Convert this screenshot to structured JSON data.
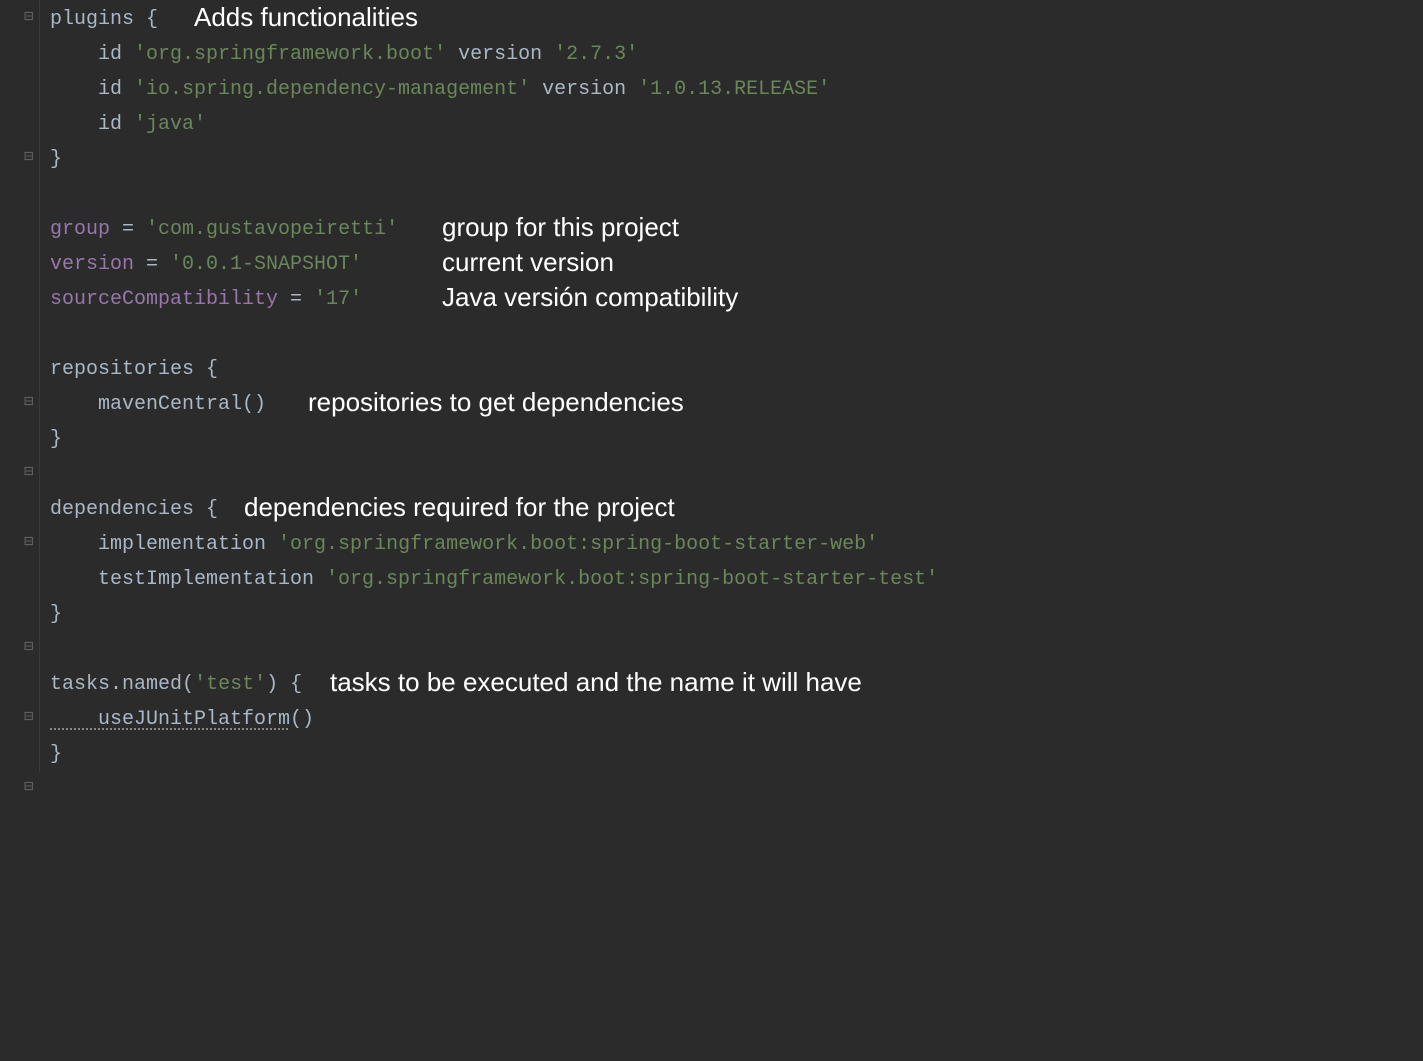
{
  "code": {
    "l1_plugins": "plugins",
    "l1_brace": " {",
    "l2_id": "    id ",
    "l2_str": "'org.springframework.boot' ",
    "l2_version": "version ",
    "l2_vstr": "'2.7.3'",
    "l3_id": "    id ",
    "l3_str": "'io.spring.dependency-management' ",
    "l3_version": "version ",
    "l3_vstr": "'1.0.13.RELEASE'",
    "l4_id": "    id ",
    "l4_str": "'java'",
    "l5_brace": "}",
    "l7_group": "group ",
    "l7_eq": "= ",
    "l7_str": "'com.gustavopeiretti'",
    "l8_version": "version ",
    "l8_eq": "= ",
    "l8_str": "'0.0.1-SNAPSHOT'",
    "l9_sc": "sourceCompatibility ",
    "l9_eq": "= ",
    "l9_str": "'17'",
    "l11_repos": "repositories",
    "l11_brace": " {",
    "l12_maven": "    mavenCentral()",
    "l13_brace": "}",
    "l15_deps": "dependencies",
    "l15_brace": " {",
    "l16_impl": "    implementation ",
    "l16_str": "'org.springframework.boot:spring-boot-starter-web'",
    "l17_timpl": "    testImplementation ",
    "l17_str": "'org.springframework.boot:spring-boot-starter-test'",
    "l18_brace": "}",
    "l20_tasks": "tasks",
    "l20_dot": ".",
    "l20_named": "named",
    "l20_p1": "(",
    "l20_test": "'test'",
    "l20_p2": ") ",
    "l20_brace": "{",
    "l21_junit": "    useJUnitPlatform",
    "l21_parens": "()",
    "l22_brace": "}"
  },
  "annotations": {
    "adds": "Adds functionalities",
    "group": "group for this project",
    "version": "current version",
    "java": "Java versión compatibility",
    "repos": "repositories to get dependencies",
    "deps": "dependencies required for the project",
    "tasks": "tasks to be executed and the name it will have"
  },
  "fold": {
    "open": "⊟",
    "close": "⊟"
  }
}
